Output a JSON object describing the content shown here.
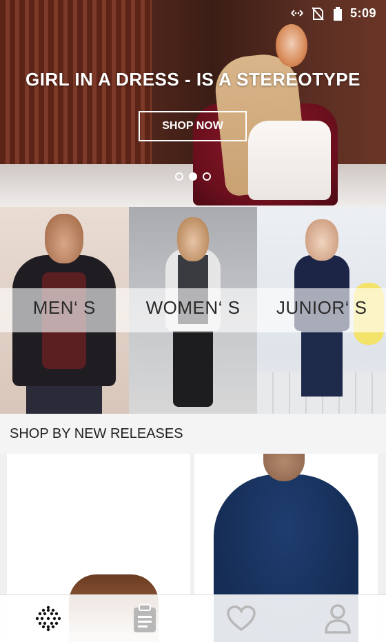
{
  "status_bar": {
    "time": "5:09",
    "icons": [
      "data-sync-icon",
      "no-sim-icon",
      "battery-icon"
    ]
  },
  "hero": {
    "title": "GIRL IN A DRESS - IS A STEREOTYPE",
    "cta_label": "SHOP NOW",
    "slides_count": 3,
    "active_slide": 2
  },
  "categories": [
    {
      "label": "MEN‘ S"
    },
    {
      "label": "WOMEN‘ S"
    },
    {
      "label": "JUNIOR‘ S"
    }
  ],
  "new_releases": {
    "heading": "SHOP BY NEW RELEASES",
    "products": [
      {
        "image": "brown-boot"
      },
      {
        "image": "navy-sweater"
      }
    ]
  },
  "bottom_nav": {
    "items": [
      {
        "icon": "grid-dots-icon",
        "active": true
      },
      {
        "icon": "clipboard-icon",
        "active": false
      },
      {
        "icon": "heart-icon",
        "active": false
      },
      {
        "icon": "user-icon",
        "active": false
      }
    ],
    "active_color": "#111111",
    "inactive_color": "#b8b8b8"
  }
}
